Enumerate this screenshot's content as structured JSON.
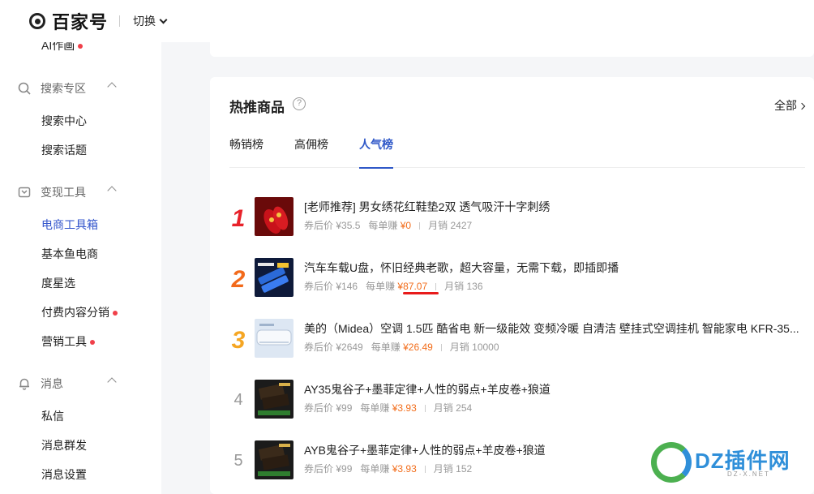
{
  "header": {
    "brand": "百家号",
    "switch_label": "切换"
  },
  "sidebar": {
    "partial_item": "AI作画",
    "groups": [
      {
        "label": "搜索专区",
        "items": [
          "搜索中心",
          "搜索话题"
        ]
      },
      {
        "label": "变现工具",
        "items": [
          "电商工具箱",
          "基本鱼电商",
          "度星选",
          "付费内容分销",
          "营销工具"
        ]
      },
      {
        "label": "消息",
        "items": [
          "私信",
          "消息群发",
          "消息设置"
        ]
      }
    ]
  },
  "main": {
    "title": "热推商品",
    "help": "?",
    "all_link": "全部",
    "tabs": [
      "畅销榜",
      "高佣榜",
      "人气榜"
    ],
    "active_tab": "人气榜",
    "products": [
      {
        "rank": "1",
        "title": "[老师推荐] 男女绣花红鞋垫2双 透气吸汗十字刺绣",
        "price_label": "券后价",
        "price": "¥35.5",
        "earn_label": "每单赚",
        "earn": "¥0",
        "sales_label": "月销",
        "sales": "2427"
      },
      {
        "rank": "2",
        "title": "汽车车载U盘，怀旧经典老歌，超大容量，无需下载，即插即播",
        "price_label": "券后价",
        "price": "¥146",
        "earn_label": "每单赚",
        "earn": "¥87.07",
        "sales_label": "月销",
        "sales": "136"
      },
      {
        "rank": "3",
        "title": "美的（Midea）空调 1.5匹 酷省电 新一级能效 变频冷暖 自清洁 壁挂式空调挂机 智能家电 KFR-35...",
        "price_label": "券后价",
        "price": "¥2649",
        "earn_label": "每单赚",
        "earn": "¥26.49",
        "sales_label": "月销",
        "sales": "10000"
      },
      {
        "rank": "4",
        "title": "AY35鬼谷子+墨菲定律+人性的弱点+羊皮卷+狼道",
        "price_label": "券后价",
        "price": "¥99",
        "earn_label": "每单赚",
        "earn": "¥3.93",
        "sales_label": "月销",
        "sales": "254"
      },
      {
        "rank": "5",
        "title": "AYB鬼谷子+墨菲定律+人性的弱点+羊皮卷+狼道",
        "price_label": "券后价",
        "price": "¥99",
        "earn_label": "每单赚",
        "earn": "¥3.93",
        "sales_label": "月销",
        "sales": "152"
      }
    ],
    "rank_colors": [
      "#e8222a",
      "#f26a1b",
      "#f5a623"
    ]
  },
  "watermark": {
    "text": "DZ插件网",
    "sub": "DZ-X.NET"
  }
}
